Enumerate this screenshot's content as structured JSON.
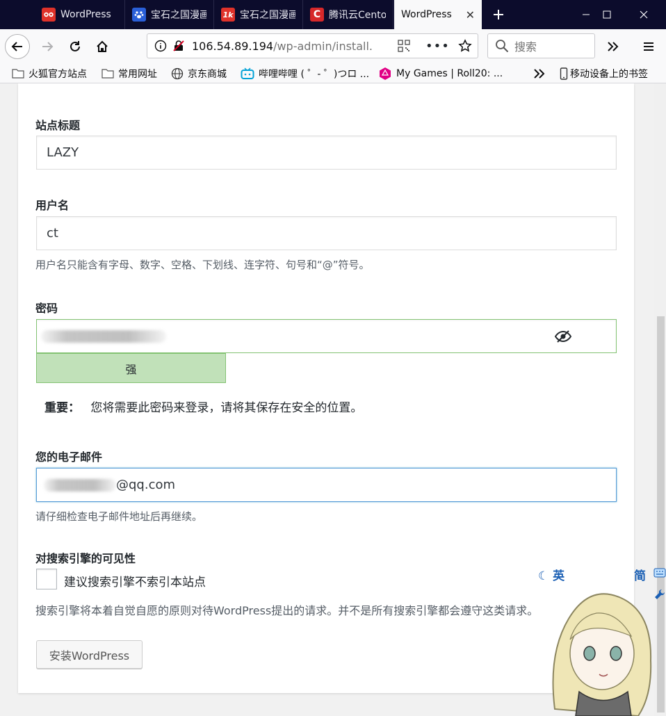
{
  "tabs": [
    {
      "label": "WordPress",
      "icon": "wordpress-icon",
      "color": "#e0322a"
    },
    {
      "label": "宝石之国漫画",
      "icon": "baidu-paw-icon",
      "color": "#2a5fd8"
    },
    {
      "label": "宝石之国漫画",
      "icon": "manhua-1k-icon",
      "color": "#e0322a"
    },
    {
      "label": "腾讯云Centos",
      "icon": "tencent-cloud-icon",
      "color": "#d7282a"
    },
    {
      "label": "WordPress",
      "icon": "wordpress-icon",
      "active": true
    }
  ],
  "url": {
    "host": "106.54.89.194",
    "path": "/wp-admin/install."
  },
  "search": {
    "placeholder": "搜索"
  },
  "bookmarks": [
    {
      "label": "火狐官方站点",
      "icon": "folder-icon"
    },
    {
      "label": "常用网址",
      "icon": "folder-icon"
    },
    {
      "label": "京东商城",
      "icon": "globe-icon"
    },
    {
      "label": "哔哩哔哩 ( ゜- ゜)つロ ...",
      "icon": "bilibili-icon"
    },
    {
      "label": "My Games | Roll20: ...",
      "icon": "roll20-icon"
    },
    {
      "label": "移动设备上的书签",
      "icon": "mobile-icon"
    }
  ],
  "form": {
    "site_title_label": "站点标题",
    "site_title_value": "LAZY",
    "username_label": "用户名",
    "username_value": "ct",
    "username_hint": "用户名只能含有字母、数字、空格、下划线、连字符、句号和“@”符号。",
    "password_label": "密码",
    "password_strength": "强",
    "password_important_label": "重要：",
    "password_important_text": "您将需要此密码来登录，请将其保存在安全的位置。",
    "email_label": "您的电子邮件",
    "email_suffix": "@qq.com",
    "email_hint": "请仔细检查电子邮件地址后再继续。",
    "visibility_label": "对搜索引擎的可见性",
    "visibility_checkbox_label": "建议搜索引擎不索引本站点",
    "visibility_hint": "搜索引擎将本着自觉自愿的原则对待WordPress提出的请求。并不是所有搜索引擎都会遵守这类请求。",
    "install_button": "安装WordPress"
  },
  "ime": {
    "lang": "英",
    "mode": "简"
  },
  "colors": {
    "titlebar": "#0c0c2c",
    "strength_bg": "#c1e1b9",
    "strength_border": "#83c373",
    "focus": "#5b9dd9"
  }
}
